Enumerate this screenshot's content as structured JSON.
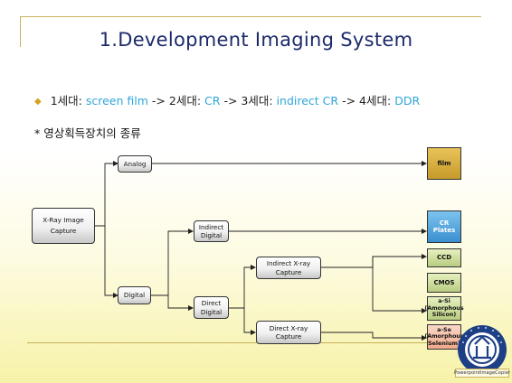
{
  "slide": {
    "title": "1.Development Imaging System",
    "generations": {
      "g1": "1세대:",
      "g1_value": "screen film",
      "arrow1": "->",
      "g2": "2세대:",
      "g2_value": "CR",
      "arrow2": "->",
      "g3": "3세대:",
      "g3_value": "indirect CR",
      "arrow3": "->",
      "g4": "4세대:",
      "g4_value": "DDR"
    },
    "subtitle": "* 영상획득장치의 종류",
    "highlight_color": "#2fa6d8",
    "title_color": "#1c2a6b"
  },
  "diagram": {
    "root_line1": "X-Ray Image",
    "root_line2": "Capture",
    "analog": "Analog",
    "digital": "Digital",
    "indirect_digital_line1": "Indirect",
    "indirect_digital_line2": "Digital",
    "direct_digital_line1": "Direct",
    "direct_digital_line2": "Digital",
    "indirect_xray_line1": "Indirect X-ray",
    "indirect_xray_line2": "Capture",
    "direct_xray_line1": "Direct X-ray",
    "direct_xray_line2": "Capture",
    "film": "film",
    "cr_plates": "CR Plates",
    "ccd": "CCD",
    "cmos": "CMOS",
    "asi_line1": "a-Si",
    "asi_line2": "(Amorphous",
    "asi_line3": "Silicon)",
    "ase_line1": "a-Se",
    "ase_line2": "(Amorphous",
    "ase_line3": "Selenium)"
  },
  "logo": {
    "caption": "PowerpointImageCopier"
  }
}
